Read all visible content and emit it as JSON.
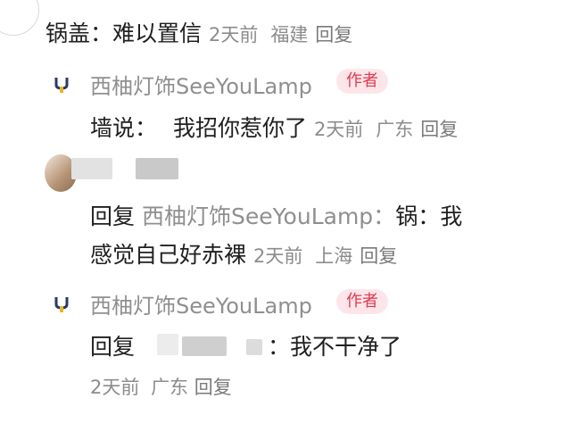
{
  "comment1": {
    "name": "锅盖：",
    "text": "难以置信",
    "time": "2天前",
    "location": "福建",
    "reply": "回复"
  },
  "reply1": {
    "author": "西柚灯饰SeeYouLamp",
    "badge": "作者",
    "to": "墙说：",
    "text": "我招你惹你了",
    "time": "2天前",
    "location": "广东",
    "reply": "回复"
  },
  "reply2": {
    "prefix": "回复",
    "to_name": "西柚灯饰SeeYouLamp",
    "colon": "：",
    "text_line1": "锅：我",
    "text_line2": "感觉自己好赤裸",
    "time": "2天前",
    "location": "上海",
    "reply": "回复"
  },
  "reply3": {
    "author": "西柚灯饰SeeYouLamp",
    "badge": "作者",
    "prefix": "回复",
    "text": "：我不干净了",
    "time": "2天前",
    "location": "广东",
    "reply": "回复"
  },
  "colors": {
    "badge_text": "#e0384e",
    "badge_bg": "#fde6ea",
    "logo_top": "#2b3b66",
    "logo_bottom": "#e8b62a"
  }
}
